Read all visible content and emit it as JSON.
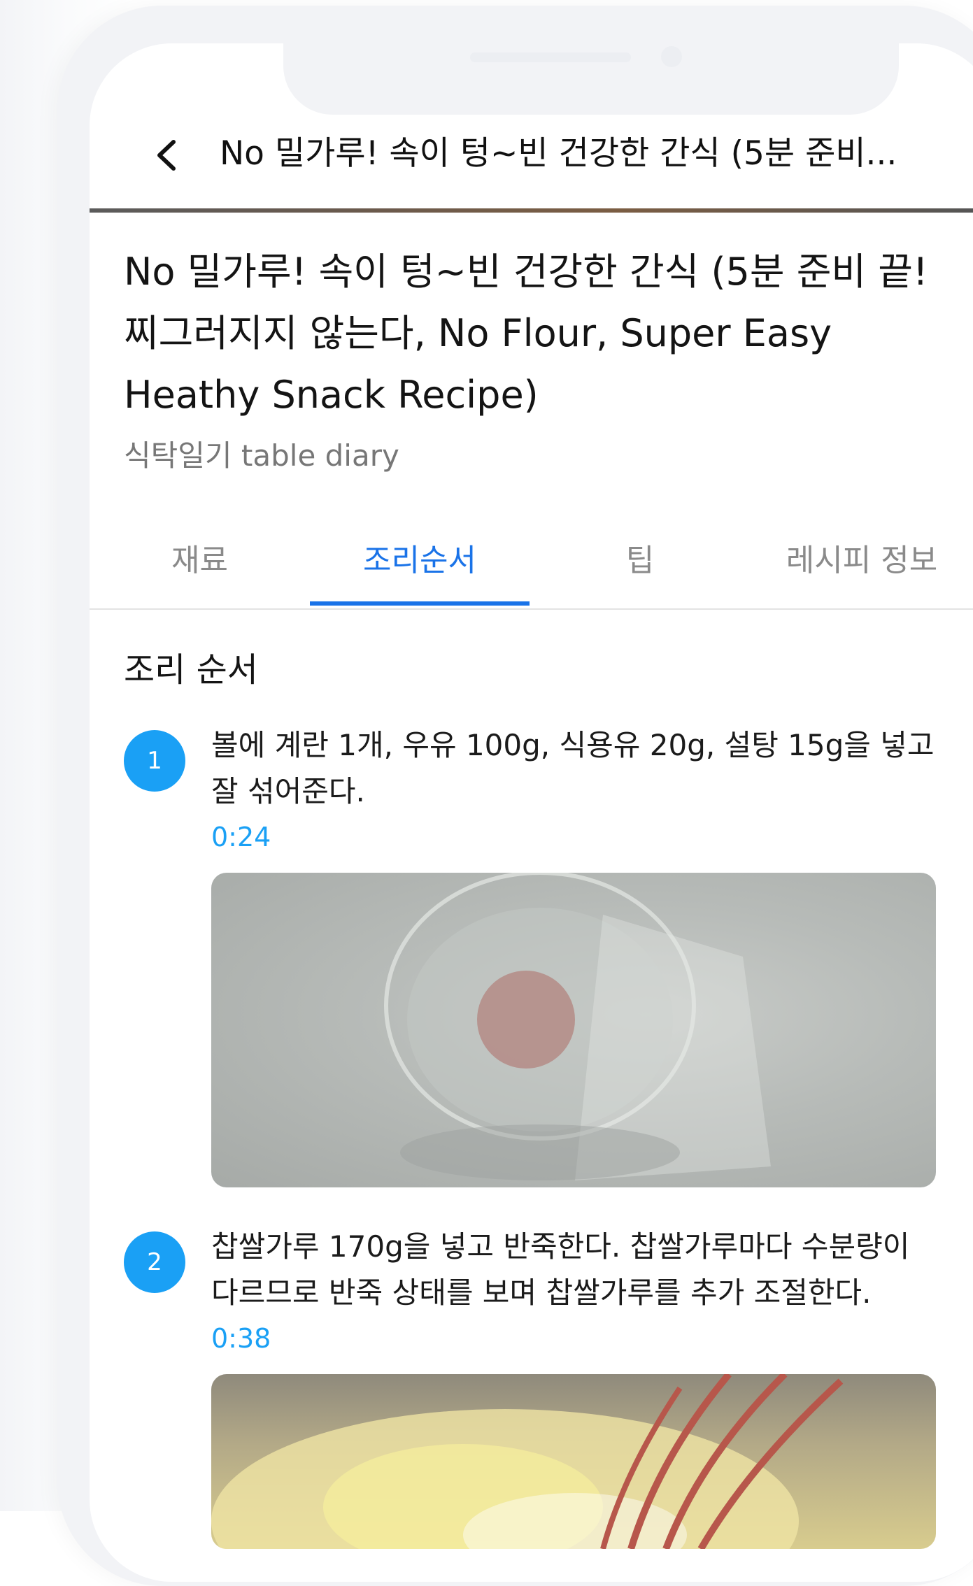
{
  "header": {
    "title": "No 밀가루! 속이 텅~빈 건강한 간식 (5분 준비..."
  },
  "recipe": {
    "title": "No 밀가루! 속이 텅~빈 건강한 간식 (5분 준비 끝! 찌그러지지 않는다, No Flour, Super Easy Heathy Snack Recipe)",
    "channel": "식탁일기 table diary"
  },
  "tabs": [
    {
      "label": "재료"
    },
    {
      "label": "조리순서"
    },
    {
      "label": "팁"
    },
    {
      "label": "레시피 정보"
    }
  ],
  "active_tab_color": "#1a73e8",
  "section_title": "조리 순서",
  "steps": [
    {
      "number": "1",
      "text": "볼에 계란 1개, 우유 100g, 식용유 20g, 설탕 15g을 넣고 잘 섞어준다.",
      "time": "0:24"
    },
    {
      "number": "2",
      "text": "찹쌀가루 170g을 넣고 반죽한다. 찹쌀가루마다 수분량이 다르므로 반죽 상태를 보며 찹쌀가루를 추가 조절한다.",
      "time": "0:38"
    }
  ],
  "accent_color": "#1aa0f5",
  "icons": {
    "back": "chevron-left-icon"
  }
}
